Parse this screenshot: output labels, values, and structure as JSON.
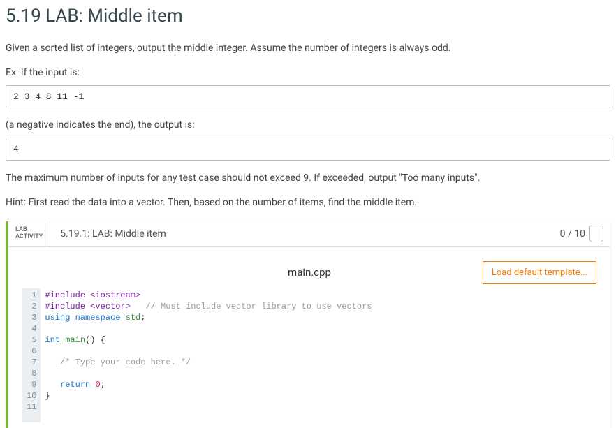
{
  "title": "5.19 LAB: Middle item",
  "description": "Given a sorted list of integers, output the middle integer. Assume the number of integers is always odd.",
  "example_input_label": "Ex: If the input is:",
  "example_input": "2 3 4 8 11 -1",
  "example_explain": "(a negative indicates the end), the output is:",
  "example_output": "4",
  "constraint": "The maximum number of inputs for any test case should not exceed 9. If exceeded, output \"Too many inputs\".",
  "hint": "Hint: First read the data into a vector. Then, based on the number of items, find the middle item.",
  "lab": {
    "badge_line1": "LAB",
    "badge_line2": "ACTIVITY",
    "title": "5.19.1: LAB: Middle item",
    "score": "0 / 10",
    "filename": "main.cpp",
    "load_template": "Load default template..."
  },
  "code": {
    "line_count": 11,
    "lines": [
      {
        "n": 1,
        "seg": [
          {
            "c": "kw-pre",
            "t": "#include"
          },
          {
            "c": "",
            "t": " "
          },
          {
            "c": "kw-str",
            "t": "<iostream>"
          }
        ]
      },
      {
        "n": 2,
        "seg": [
          {
            "c": "kw-pre",
            "t": "#include"
          },
          {
            "c": "",
            "t": " "
          },
          {
            "c": "kw-str",
            "t": "<vector>"
          },
          {
            "c": "",
            "t": "   "
          },
          {
            "c": "kw-comment",
            "t": "// Must include vector library to use vectors"
          }
        ]
      },
      {
        "n": 3,
        "seg": [
          {
            "c": "kw-blue",
            "t": "using"
          },
          {
            "c": "",
            "t": " "
          },
          {
            "c": "kw-blue",
            "t": "namespace"
          },
          {
            "c": "",
            "t": " "
          },
          {
            "c": "kw-green",
            "t": "std"
          },
          {
            "c": "",
            "t": ";"
          }
        ]
      },
      {
        "n": 4,
        "seg": []
      },
      {
        "n": 5,
        "seg": [
          {
            "c": "kw-blue",
            "t": "int"
          },
          {
            "c": "",
            "t": " "
          },
          {
            "c": "kw-green",
            "t": "main"
          },
          {
            "c": "",
            "t": "() {"
          }
        ]
      },
      {
        "n": 6,
        "seg": []
      },
      {
        "n": 7,
        "seg": [
          {
            "c": "",
            "t": "   "
          },
          {
            "c": "kw-comment",
            "t": "/* Type your code here. */"
          }
        ]
      },
      {
        "n": 8,
        "seg": []
      },
      {
        "n": 9,
        "seg": [
          {
            "c": "",
            "t": "   "
          },
          {
            "c": "kw-blue",
            "t": "return"
          },
          {
            "c": "",
            "t": " "
          },
          {
            "c": "kw-num",
            "t": "0"
          },
          {
            "c": "",
            "t": ";"
          }
        ]
      },
      {
        "n": 10,
        "seg": [
          {
            "c": "",
            "t": "}"
          }
        ]
      },
      {
        "n": 11,
        "seg": []
      }
    ]
  }
}
